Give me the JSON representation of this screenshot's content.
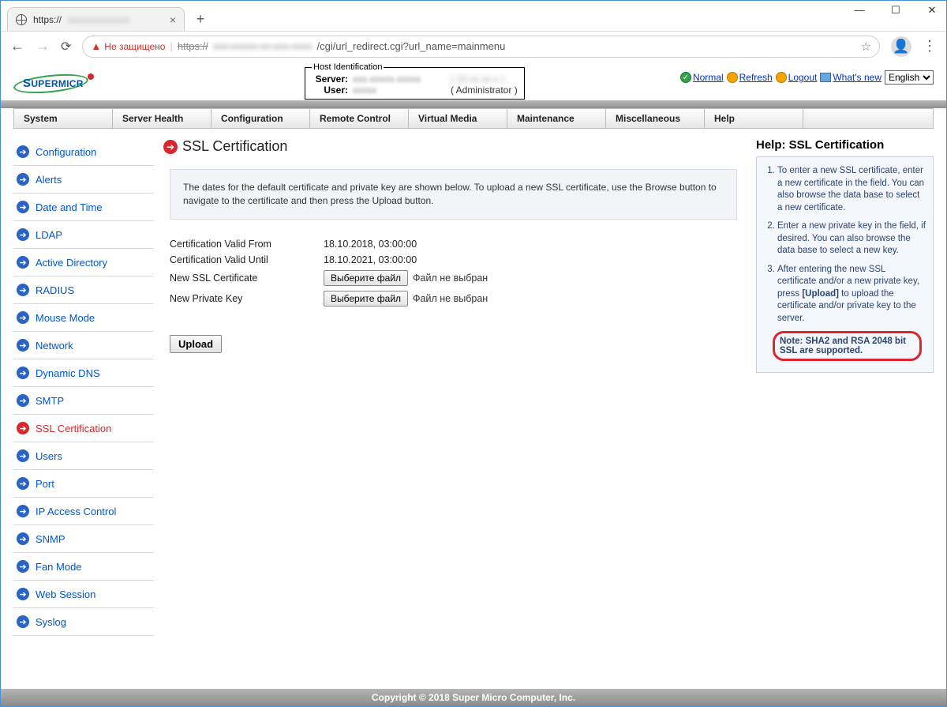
{
  "browser": {
    "tab_title": "https://",
    "address_insecure_label": "Не защищено",
    "url_strike": "https://",
    "url_rest": "/cgi/url_redirect.cgi?url_name=mainmenu"
  },
  "brand": {
    "name": "SUPERMICRO"
  },
  "host_id": {
    "legend": "Host Identification",
    "server_label": "Server:",
    "user_label": "User:",
    "role": "( Administrator )"
  },
  "top_links": {
    "normal": "Normal",
    "refresh": "Refresh",
    "logout": "Logout",
    "whats_new": "What's new",
    "language": "English"
  },
  "menu": [
    "System",
    "Server Health",
    "Configuration",
    "Remote Control",
    "Virtual Media",
    "Maintenance",
    "Miscellaneous",
    "Help"
  ],
  "sidebar": {
    "items": [
      {
        "label": "Configuration",
        "active": false
      },
      {
        "label": "Alerts",
        "active": false
      },
      {
        "label": "Date and Time",
        "active": false
      },
      {
        "label": "LDAP",
        "active": false
      },
      {
        "label": "Active Directory",
        "active": false
      },
      {
        "label": "RADIUS",
        "active": false
      },
      {
        "label": "Mouse Mode",
        "active": false
      },
      {
        "label": "Network",
        "active": false
      },
      {
        "label": "Dynamic DNS",
        "active": false
      },
      {
        "label": "SMTP",
        "active": false
      },
      {
        "label": "SSL Certification",
        "active": true
      },
      {
        "label": "Users",
        "active": false
      },
      {
        "label": "Port",
        "active": false
      },
      {
        "label": "IP Access Control",
        "active": false
      },
      {
        "label": "SNMP",
        "active": false
      },
      {
        "label": "Fan Mode",
        "active": false
      },
      {
        "label": "Web Session",
        "active": false
      },
      {
        "label": "Syslog",
        "active": false
      }
    ]
  },
  "page_title": "SSL Certification",
  "intro_text": "The dates for the default certificate and private key are shown below. To upload a new SSL certificate, use the Browse button to navigate to the certificate and then press the Upload button.",
  "form": {
    "valid_from_label": "Certification Valid From",
    "valid_from_value": "18.10.2018, 03:00:00",
    "valid_until_label": "Certification Valid Until",
    "valid_until_value": "18.10.2021, 03:00:00",
    "new_cert_label": "New SSL Certificate",
    "new_key_label": "New Private Key",
    "choose_file_btn": "Выберите файл",
    "no_file_text": "Файл не выбран",
    "upload_btn": "Upload"
  },
  "help": {
    "title": "Help: SSL Certification",
    "items": [
      "To enter a new SSL certificate, enter a new certificate in the field. You can also browse the data base to select a new certificate.",
      "Enter a new private key in the field, if desired. You can also browse the data base to select a new key.",
      "After entering the new SSL certificate and/or a new private key, press [Upload] to upload the certificate and/or private key to the server."
    ],
    "note": "Note: SHA2 and RSA 2048 bit SSL are supported."
  },
  "footer": "Copyright © 2018 Super Micro Computer, Inc."
}
